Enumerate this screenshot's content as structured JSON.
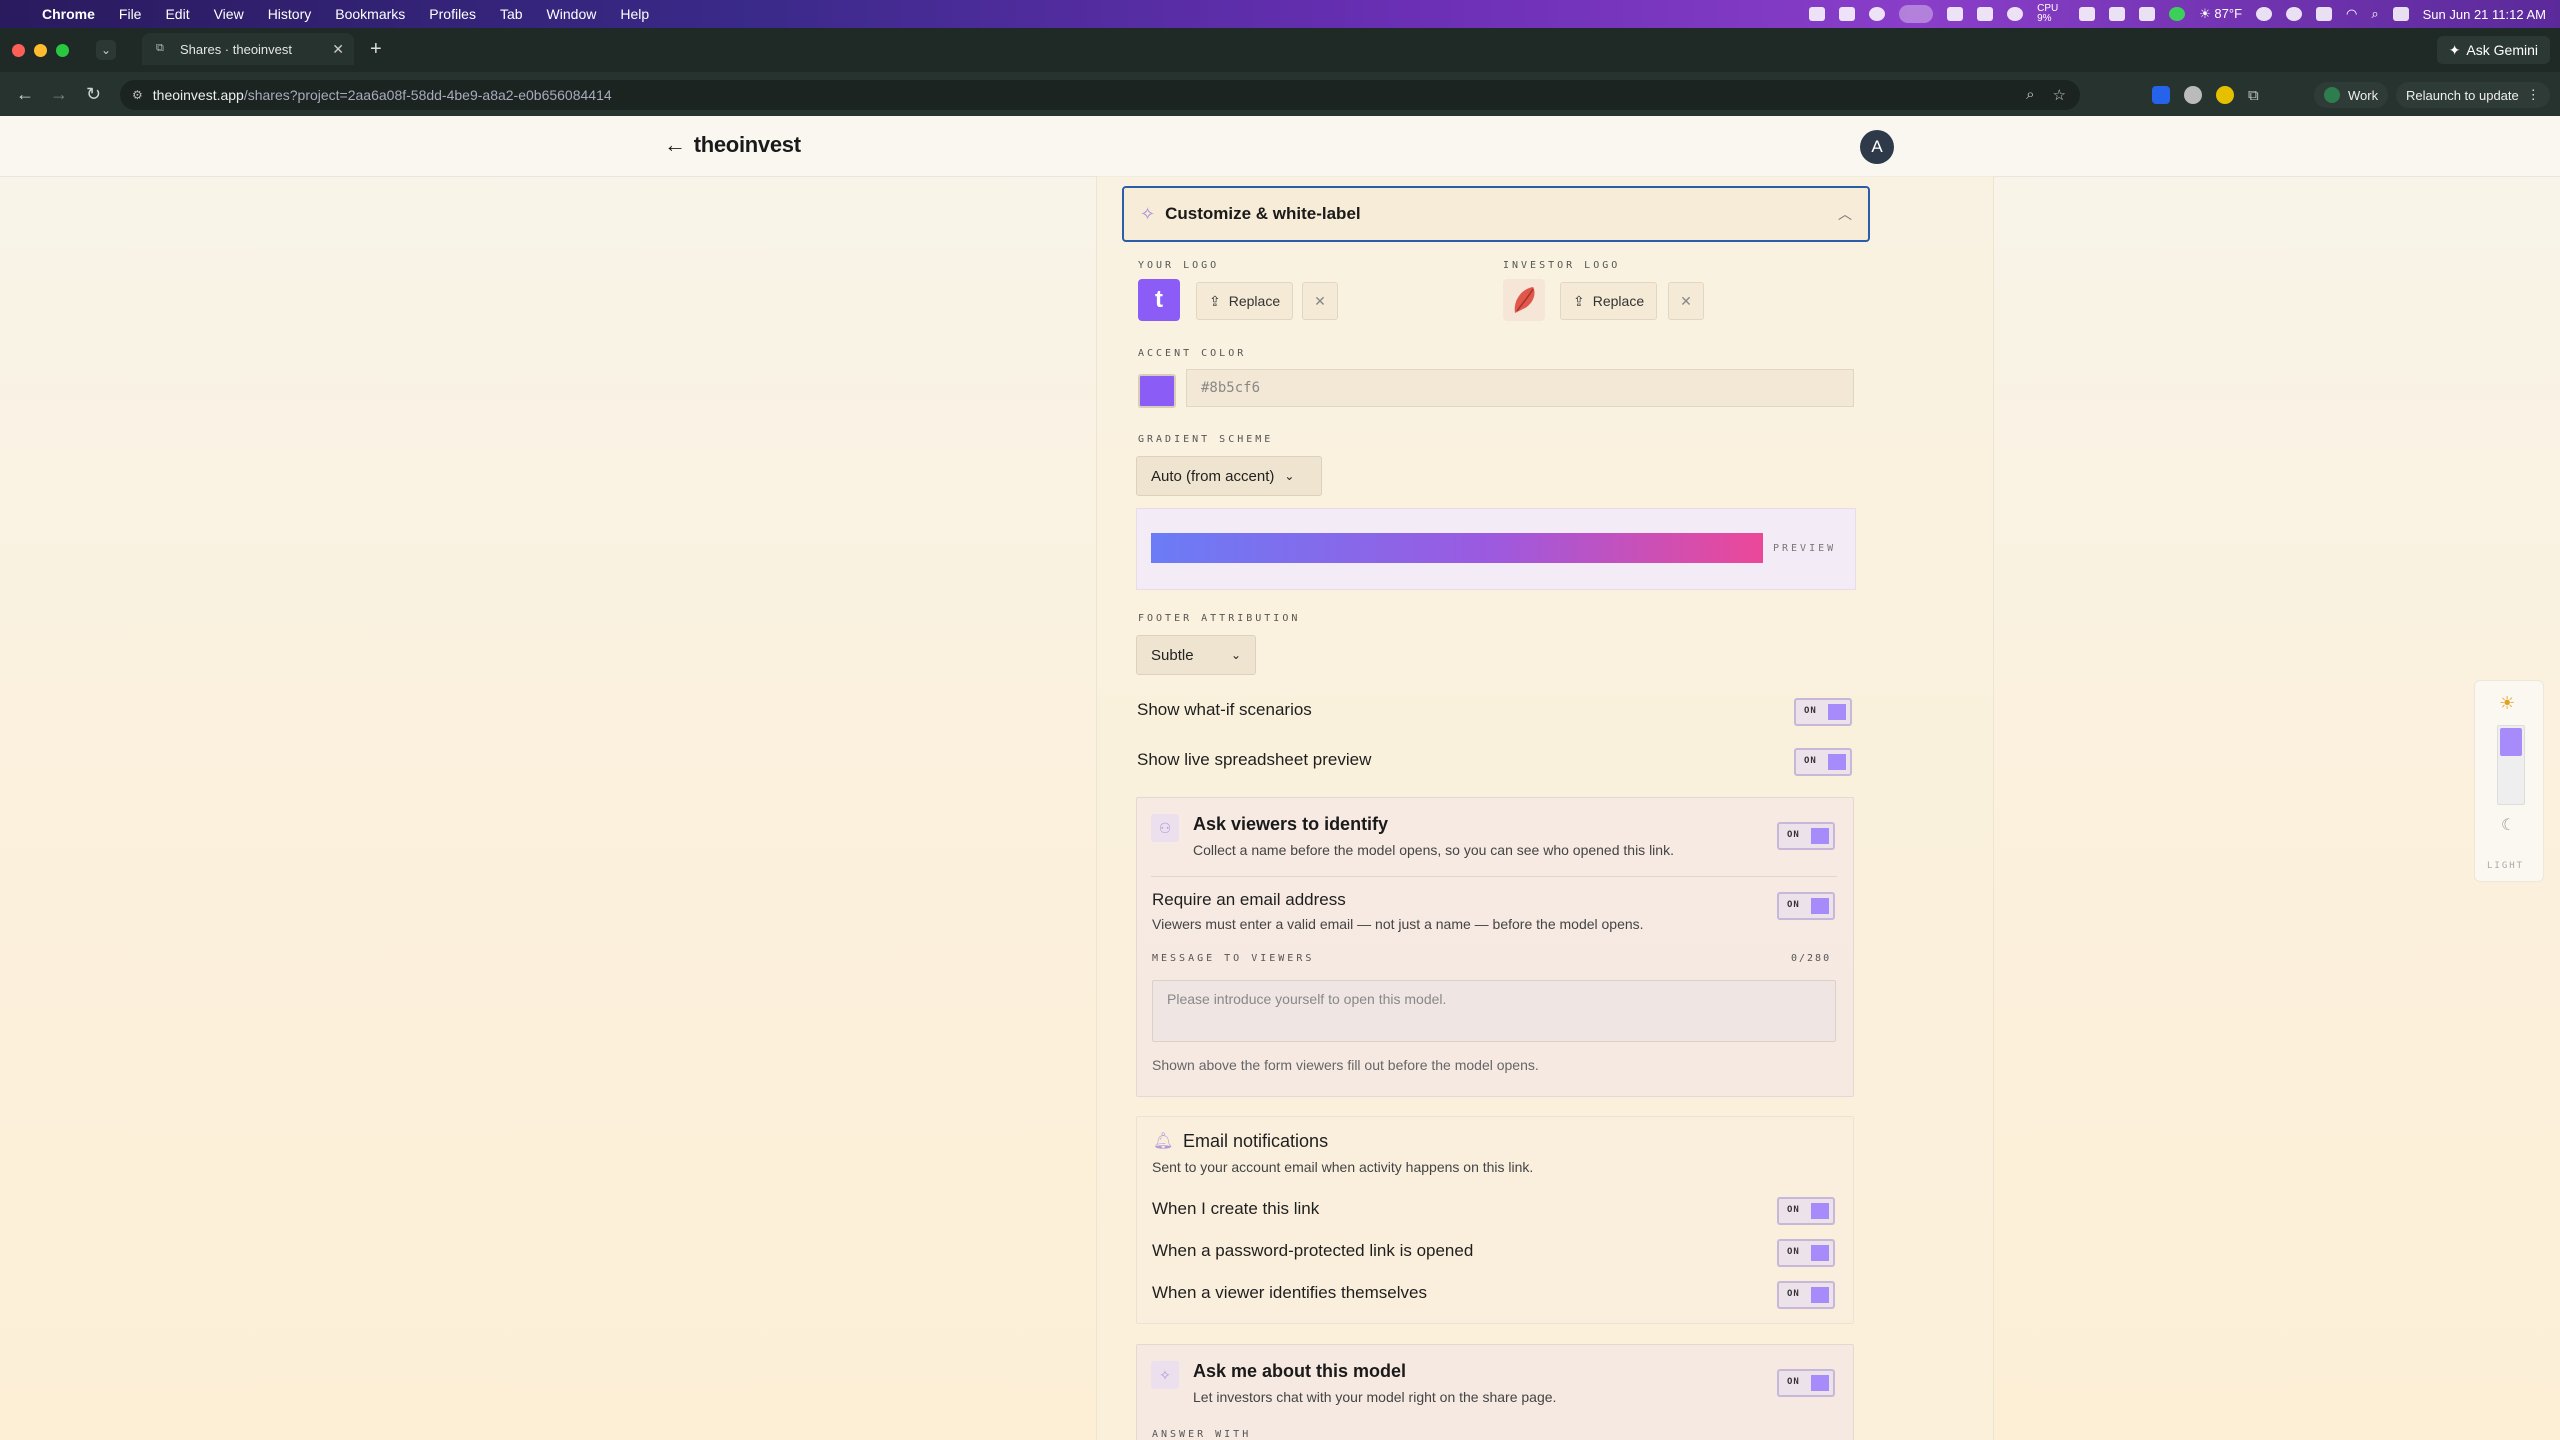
{
  "os_menubar": {
    "app": "Chrome",
    "menus": [
      "File",
      "Edit",
      "View",
      "History",
      "Bookmarks",
      "Profiles",
      "Tab",
      "Window",
      "Help"
    ],
    "cpu": "CPU 9%",
    "weather": "87°F",
    "datetime": "Sun Jun 21  11:12 AM"
  },
  "browser": {
    "tab_title": "Shares · theoinvest",
    "url_host": "theoinvest.app",
    "url_path": "/shares?project=2aa6a08f-58dd-4be9-a8a2-e0b656084414",
    "ask_gemini": "Ask Gemini",
    "profile": "Work",
    "relaunch": "Relaunch to update"
  },
  "app": {
    "brand": "theoinvest",
    "back_arrow": "←",
    "avatar_letter": "A"
  },
  "section": {
    "title": "Customize & white-label",
    "your_logo_label": "YOUR LOGO",
    "investor_logo_label": "INVESTOR LOGO",
    "replace_label": "Replace",
    "accent_color_label": "ACCENT COLOR",
    "accent_color_value": "#8b5cf6",
    "gradient_scheme_label": "GRADIENT SCHEME",
    "gradient_scheme_value": "Auto (from accent)",
    "preview_label": "PREVIEW",
    "footer_attribution_label": "FOOTER ATTRIBUTION",
    "footer_attribution_value": "Subtle",
    "toggle_on": "ON",
    "show_whatif": "Show what-if scenarios",
    "show_spreadsheet": "Show live spreadsheet preview"
  },
  "identify_card": {
    "title": "Ask viewers to identify",
    "desc": "Collect a name before the model opens, so you can see who opened this link.",
    "require_email_title": "Require an email address",
    "require_email_desc": "Viewers must enter a valid email — not just a name — before the model opens.",
    "message_label": "MESSAGE TO VIEWERS",
    "message_count": "0/280",
    "message_placeholder": "Please introduce yourself to open this model.",
    "message_hint": "Shown above the form viewers fill out before the model opens."
  },
  "notifications": {
    "title": "Email notifications",
    "desc": "Sent to your account email when activity happens on this link.",
    "items": [
      "When I create this link",
      "When a password-protected link is opened",
      "When a viewer identifies themselves"
    ]
  },
  "ask_card": {
    "title": "Ask me about this model",
    "desc": "Let investors chat with your model right on the share page.",
    "answer_with_label": "ANSWER WITH"
  },
  "theme_widget": {
    "label": "LIGHT"
  },
  "colors": {
    "accent": "#8b5cf6",
    "gradient_start": "#6b7cf6",
    "gradient_end": "#ec4899"
  }
}
